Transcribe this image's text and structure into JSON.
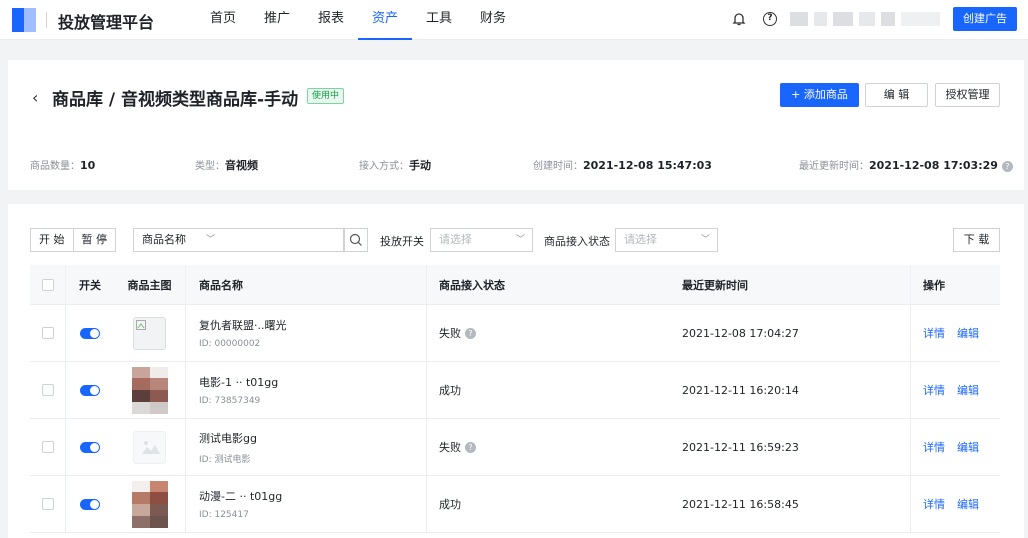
{
  "brand": "投放管理平台",
  "nav": [
    "首页",
    "推广",
    "报表",
    "资产",
    "工具",
    "财务"
  ],
  "nav_active": "资产",
  "create_ad": "创建广告",
  "header": {
    "back": "‹",
    "title": "商品库 / 音视频类型商品库-手动",
    "status_tag": "使用中",
    "add_label": "+ 添加商品",
    "edit_label": "编 辑",
    "auth_label": "授权管理"
  },
  "meta": {
    "count_label": "商品数量：",
    "count_value": "10",
    "type_label": "类型：",
    "type_value": "音视频",
    "access_label": "接入方式：",
    "access_value": "手动",
    "created_label": "创建时间：",
    "created_value": "2021-12-08 15:47:03",
    "updated_label": "最近更新时间：",
    "updated_value": "2021-12-08 17:03:29"
  },
  "toolbar": {
    "start": "开 始",
    "pause": "暂 停",
    "field_select": "商品名称",
    "switch_label": "投放开关",
    "switch_placeholder": "请选择",
    "access_status_label": "商品接入状态",
    "access_status_placeholder": "请选择",
    "download": "下 载"
  },
  "columns": [
    "开关",
    "商品主图",
    "商品名称",
    "商品接入状态",
    "最近更新时间",
    "操作"
  ],
  "rows": [
    {
      "name": "复仇者联盟·..曙光",
      "id": "ID: 00000002",
      "status": "失败",
      "time": "2021-12-08 17:04:27"
    },
    {
      "name": "电影-1 ·· t01gg",
      "id": "ID: 73857349",
      "status": "成功",
      "time": "2021-12-11 16:20:14"
    },
    {
      "name": "测试电影gg",
      "id": "ID: 测试电影",
      "status": "失败",
      "time": "2021-12-11 16:59:23"
    },
    {
      "name": "动漫-二 ·· t01gg",
      "id": "ID: 125417",
      "status": "成功",
      "time": "2021-12-11 16:58:45"
    }
  ],
  "ops": {
    "detail": "详情",
    "edit": "编辑"
  },
  "colors": {
    "accent": "#1966ff",
    "success_tag": "#13a047"
  }
}
